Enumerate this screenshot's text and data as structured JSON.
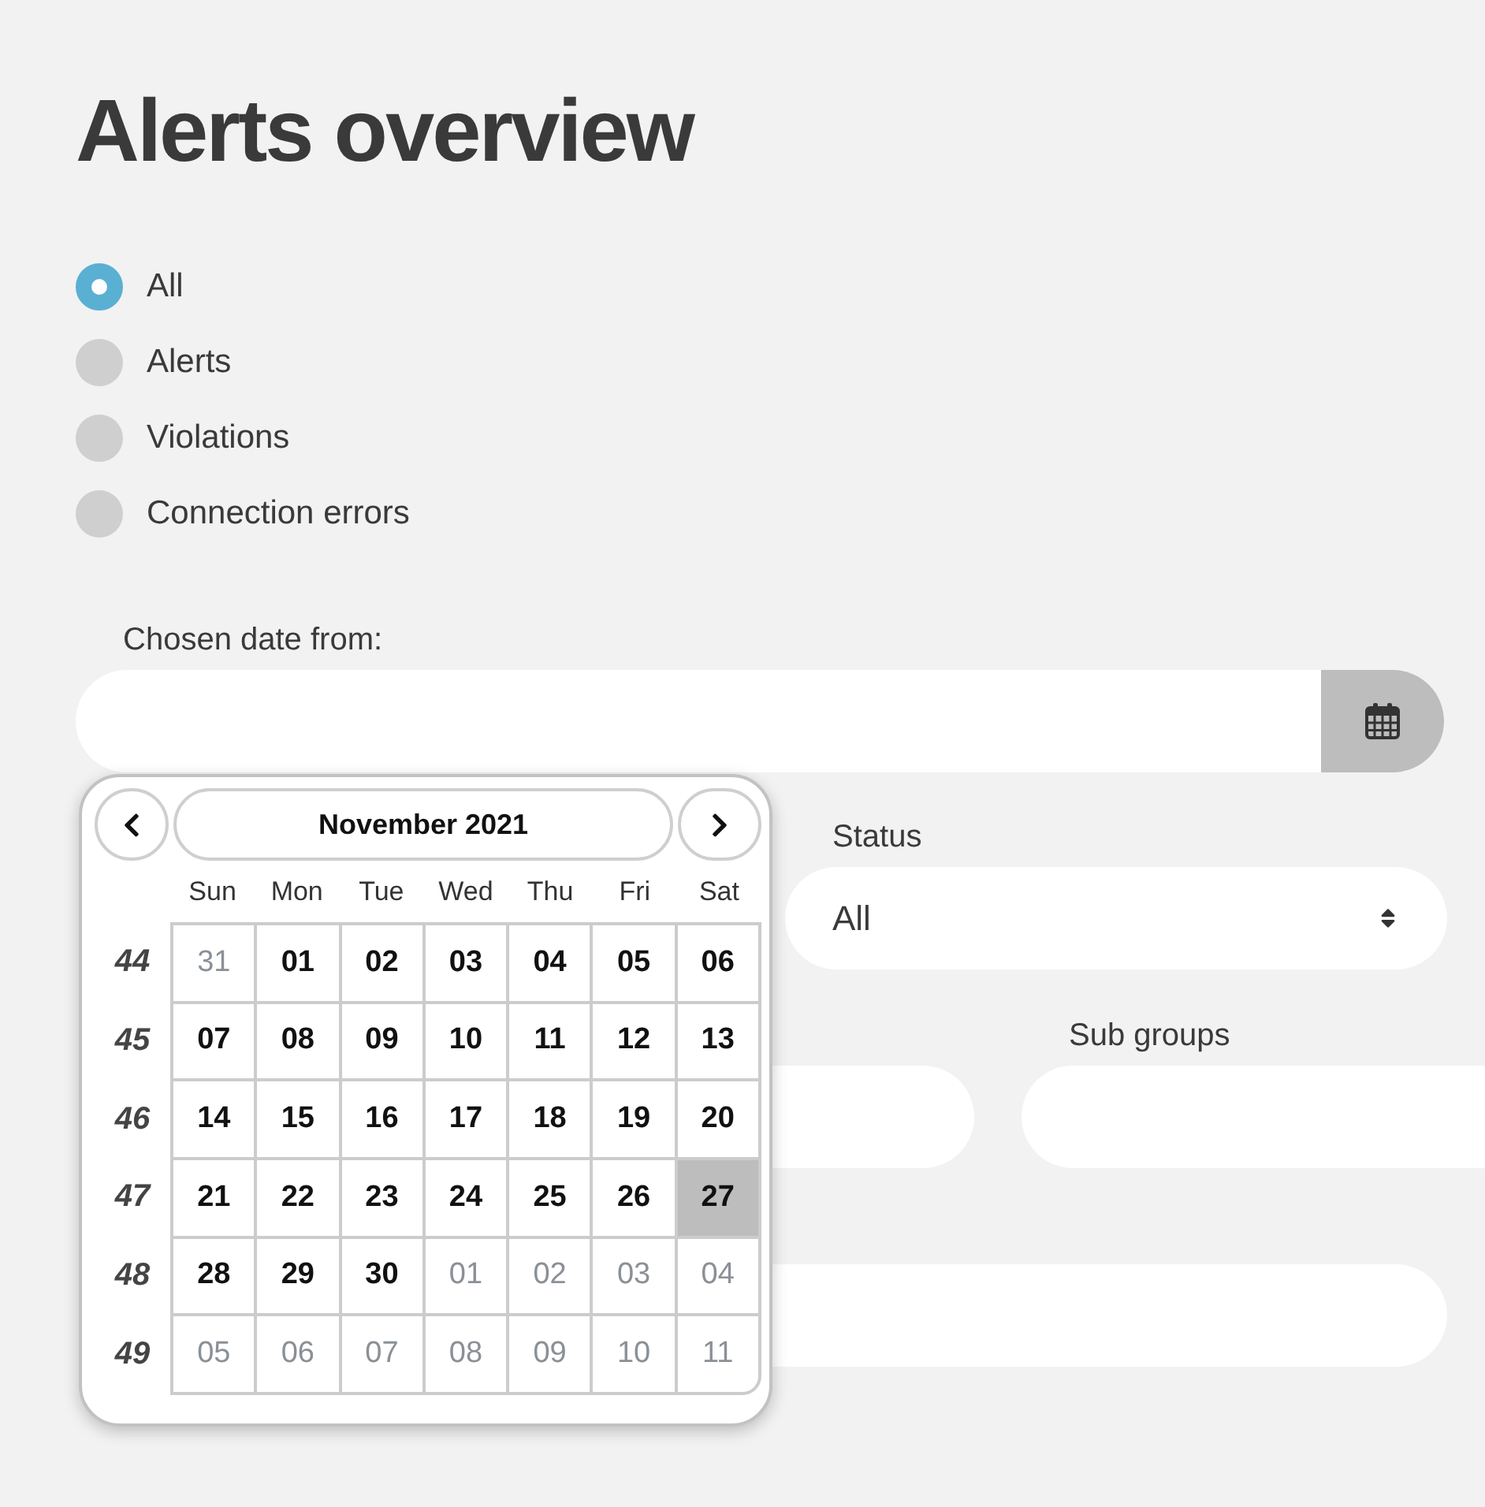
{
  "title": "Alerts overview",
  "filter_options": [
    {
      "label": "All",
      "selected": true
    },
    {
      "label": "Alerts",
      "selected": false
    },
    {
      "label": "Violations",
      "selected": false
    },
    {
      "label": "Connection errors",
      "selected": false
    }
  ],
  "date_from": {
    "label": "Chosen date from:"
  },
  "date_picker": {
    "month": "November 2021",
    "weekdays": [
      "Sun",
      "Mon",
      "Tue",
      "Wed",
      "Thu",
      "Fri",
      "Sat"
    ],
    "weeks": [
      {
        "number": "44",
        "days": [
          {
            "day": "31",
            "outside": true,
            "selected": false
          },
          {
            "day": "01",
            "outside": false,
            "selected": false
          },
          {
            "day": "02",
            "outside": false,
            "selected": false
          },
          {
            "day": "03",
            "outside": false,
            "selected": false
          },
          {
            "day": "04",
            "outside": false,
            "selected": false
          },
          {
            "day": "05",
            "outside": false,
            "selected": false
          },
          {
            "day": "06",
            "outside": false,
            "selected": false
          }
        ]
      },
      {
        "number": "45",
        "days": [
          {
            "day": "07",
            "outside": false,
            "selected": false
          },
          {
            "day": "08",
            "outside": false,
            "selected": false
          },
          {
            "day": "09",
            "outside": false,
            "selected": false
          },
          {
            "day": "10",
            "outside": false,
            "selected": false
          },
          {
            "day": "11",
            "outside": false,
            "selected": false
          },
          {
            "day": "12",
            "outside": false,
            "selected": false
          },
          {
            "day": "13",
            "outside": false,
            "selected": false
          }
        ]
      },
      {
        "number": "46",
        "days": [
          {
            "day": "14",
            "outside": false,
            "selected": false
          },
          {
            "day": "15",
            "outside": false,
            "selected": false
          },
          {
            "day": "16",
            "outside": false,
            "selected": false
          },
          {
            "day": "17",
            "outside": false,
            "selected": false
          },
          {
            "day": "18",
            "outside": false,
            "selected": false
          },
          {
            "day": "19",
            "outside": false,
            "selected": false
          },
          {
            "day": "20",
            "outside": false,
            "selected": false
          }
        ]
      },
      {
        "number": "47",
        "days": [
          {
            "day": "21",
            "outside": false,
            "selected": false
          },
          {
            "day": "22",
            "outside": false,
            "selected": false
          },
          {
            "day": "23",
            "outside": false,
            "selected": false
          },
          {
            "day": "24",
            "outside": false,
            "selected": false
          },
          {
            "day": "25",
            "outside": false,
            "selected": false
          },
          {
            "day": "26",
            "outside": false,
            "selected": false
          },
          {
            "day": "27",
            "outside": false,
            "selected": true
          }
        ]
      },
      {
        "number": "48",
        "days": [
          {
            "day": "28",
            "outside": false,
            "selected": false
          },
          {
            "day": "29",
            "outside": false,
            "selected": false
          },
          {
            "day": "30",
            "outside": false,
            "selected": false
          },
          {
            "day": "01",
            "outside": true,
            "selected": false
          },
          {
            "day": "02",
            "outside": true,
            "selected": false
          },
          {
            "day": "03",
            "outside": true,
            "selected": false
          },
          {
            "day": "04",
            "outside": true,
            "selected": false
          }
        ]
      },
      {
        "number": "49",
        "days": [
          {
            "day": "05",
            "outside": true,
            "selected": false
          },
          {
            "day": "06",
            "outside": true,
            "selected": false
          },
          {
            "day": "07",
            "outside": true,
            "selected": false
          },
          {
            "day": "08",
            "outside": true,
            "selected": false
          },
          {
            "day": "09",
            "outside": true,
            "selected": false
          },
          {
            "day": "10",
            "outside": true,
            "selected": false
          },
          {
            "day": "11",
            "outside": true,
            "selected": false
          }
        ]
      }
    ]
  },
  "fields": [
    {
      "kind": "select",
      "label": "Status",
      "value": "All"
    },
    {
      "kind": "text"
    },
    {
      "kind": "text",
      "label": "Sub groups"
    },
    {
      "kind": "text"
    }
  ]
}
